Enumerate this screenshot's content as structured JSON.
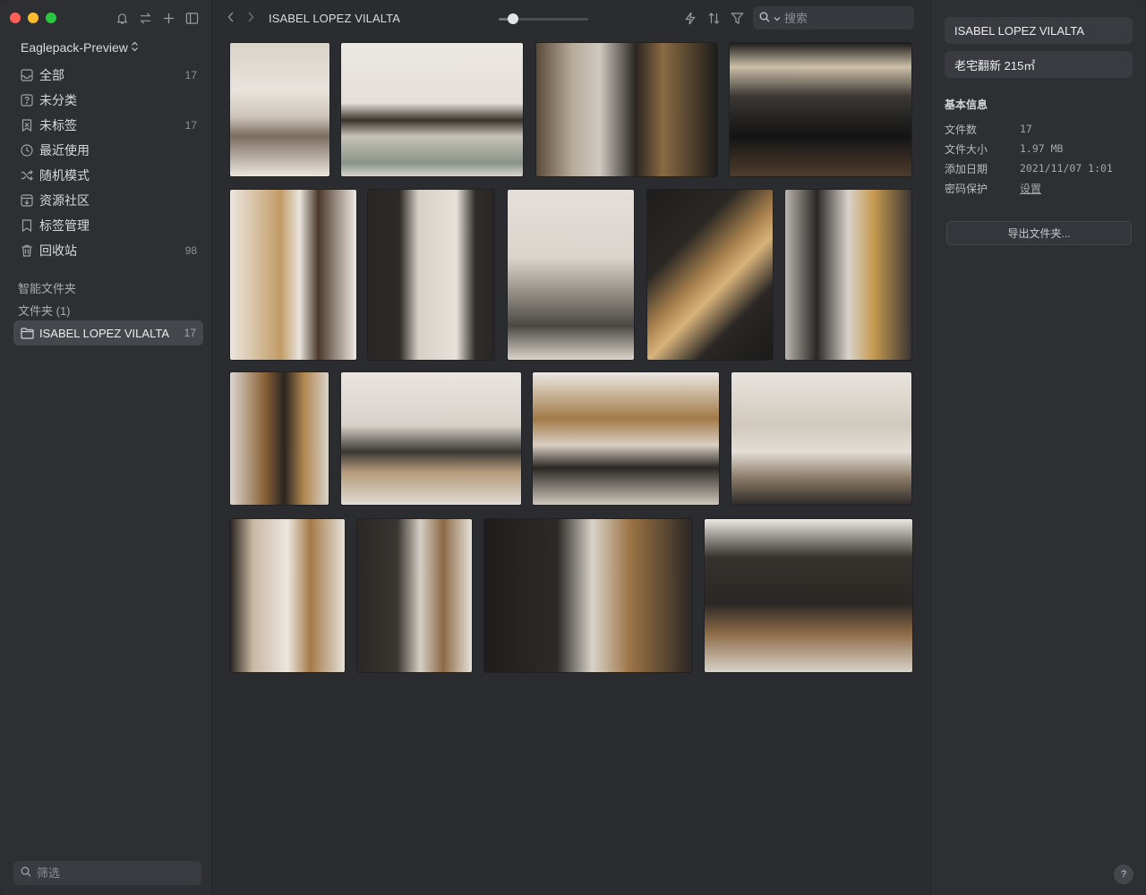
{
  "sidebar": {
    "library_name": "Eaglepack-Preview",
    "items": [
      {
        "label": "全部",
        "count": "17",
        "icon": "inbox-icon"
      },
      {
        "label": "未分类",
        "count": "",
        "icon": "question-box-icon"
      },
      {
        "label": "未标签",
        "count": "17",
        "icon": "untagged-icon"
      },
      {
        "label": "最近使用",
        "count": "",
        "icon": "clock-icon"
      },
      {
        "label": "随机模式",
        "count": "",
        "icon": "shuffle-icon"
      },
      {
        "label": "资源社区",
        "count": "",
        "icon": "download-box-icon"
      },
      {
        "label": "标签管理",
        "count": "",
        "icon": "bookmark-icon"
      },
      {
        "label": "回收站",
        "count": "98",
        "icon": "trash-icon"
      }
    ],
    "smart_folders_title": "智能文件夹",
    "folders_title": "文件夹 (1)",
    "folder": {
      "label": "ISABEL LOPEZ VILALTA",
      "count": "17"
    },
    "filter_placeholder": "筛选"
  },
  "toolbar": {
    "title": "ISABEL LOPEZ VILALTA",
    "zoom_level": 0.16,
    "search_placeholder": "搜索"
  },
  "inspector": {
    "folder_name": "ISABEL LOPEZ VILALTA",
    "description": "老宅翻新 215㎡",
    "section_title": "基本信息",
    "info": [
      {
        "key": "文件数",
        "value": "17"
      },
      {
        "key": "文件大小",
        "value": "1.97 MB"
      },
      {
        "key": "添加日期",
        "value": "2021/11/07 1:01"
      },
      {
        "key": "密码保护",
        "value": "设置"
      }
    ],
    "export_label": "导出文件夹...",
    "help_label": "?"
  },
  "colors": {
    "sidebar_bg": "#2e2f33",
    "main_bg": "#2b2c30",
    "selected_bg": "#45474d"
  }
}
